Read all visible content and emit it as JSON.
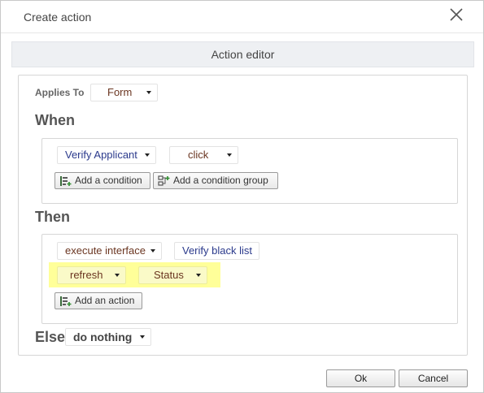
{
  "dialog": {
    "title": "Create action",
    "close_icon": "close-icon",
    "editor_header": "Action editor",
    "ok_label": "Ok",
    "cancel_label": "Cancel"
  },
  "applies_to": {
    "label": "Applies To",
    "value": "Form"
  },
  "when": {
    "heading": "When",
    "subject": "Verify Applicant",
    "event": "click",
    "add_condition_label": "Add a condition",
    "add_condition_group_label": "Add a condition group"
  },
  "then": {
    "heading": "Then",
    "action": "execute interface",
    "target": "Verify black list",
    "param_1": "refresh",
    "param_2": "Status",
    "add_action_label": "Add an action"
  },
  "else": {
    "heading": "Else",
    "value": "do nothing"
  },
  "colors": {
    "highlight": "#ffff99",
    "link_blue": "#2b3a8c",
    "value_brown": "#6a3520"
  }
}
